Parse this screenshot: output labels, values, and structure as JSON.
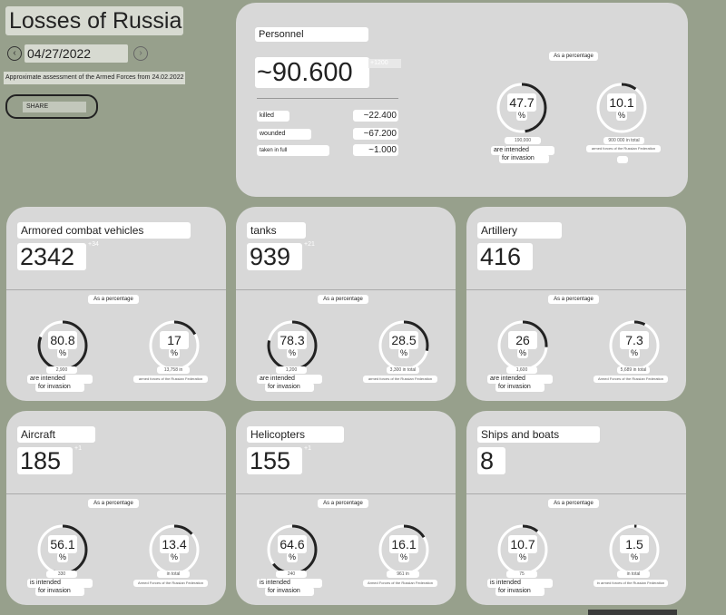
{
  "header": {
    "title": "Losses of Russia",
    "date": "04/27/2022",
    "prev_icon": "‹",
    "next_icon": "›",
    "subtitle": "Approximate assessment of the Armed Forces from 24.02.2022",
    "share_label": "SHARE"
  },
  "as_percentage_label": "As a percentage",
  "personnel": {
    "name": "Personnel",
    "value": "~90.600",
    "delta": "+1200",
    "rows": [
      {
        "label": "killed",
        "value": "~22.400"
      },
      {
        "label": "wounded",
        "value": "~67.200"
      },
      {
        "label": "taken in full",
        "value": "~1.000"
      }
    ],
    "ring1": {
      "value": "47.7",
      "sub1": "190,000",
      "sub2": "are intended",
      "sub3": "for invasion"
    },
    "ring2": {
      "value": "10.1",
      "sub1": "900 000 in total",
      "sub2": "armed forces of the Russian Federation"
    }
  },
  "cards": [
    {
      "name": "Armored combat vehicles",
      "value": "2342",
      "delta": "+34",
      "ring1": {
        "value": "80.8",
        "sub1": "2,900",
        "sub2": "are intended",
        "sub3": "for invasion"
      },
      "ring2": {
        "value": "17",
        "sub1": "13,758 in",
        "sub2": "armed forces of the Russian Federation"
      }
    },
    {
      "name": "tanks",
      "value": "939",
      "delta": "+21",
      "ring1": {
        "value": "78.3",
        "sub1": "1,200",
        "sub2": "are intended",
        "sub3": "for invasion"
      },
      "ring2": {
        "value": "28.5",
        "sub1": "3,300 in total",
        "sub2": "armed forces of the Russian Federation"
      }
    },
    {
      "name": "Artillery",
      "value": "416",
      "delta": "",
      "ring1": {
        "value": "26",
        "sub1": "1,600",
        "sub2": "are intended",
        "sub3": "for invasion"
      },
      "ring2": {
        "value": "7.3",
        "sub1": "5,689 in total",
        "sub2": "Armed Forces of the Russian Federation"
      }
    },
    {
      "name": "Aircraft",
      "value": "185",
      "delta": "+1",
      "ring1": {
        "value": "56.1",
        "sub1": "330",
        "sub2": "is intended",
        "sub3": "for invasion"
      },
      "ring2": {
        "value": "13.4",
        "sub1": "in total",
        "sub2": "Armed Forces of the Russian Federation"
      }
    },
    {
      "name": "Helicopters",
      "value": "155",
      "delta": "+1",
      "ring1": {
        "value": "64.6",
        "sub1": "240",
        "sub2": "is intended",
        "sub3": "for invasion"
      },
      "ring2": {
        "value": "16.1",
        "sub1": "961 in",
        "sub2": "Armed Forces of the Russian Federation"
      }
    },
    {
      "name": "Ships and boats",
      "value": "8",
      "delta": "",
      "ring1": {
        "value": "10.7",
        "sub1": "75",
        "sub2": "is intended",
        "sub3": "for invasion"
      },
      "ring2": {
        "value": "1.5",
        "sub1": "in total",
        "sub2": "in armed forces of the Russian Federation"
      }
    }
  ]
}
